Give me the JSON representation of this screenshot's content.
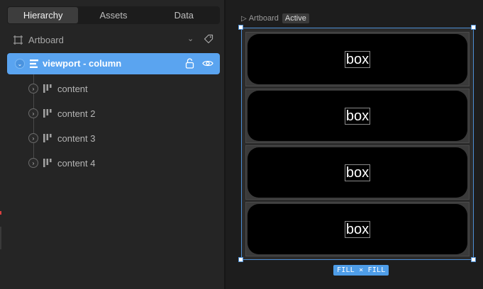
{
  "tabs": [
    {
      "label": "Hierarchy",
      "active": true
    },
    {
      "label": "Assets",
      "active": false
    },
    {
      "label": "Data",
      "active": false
    }
  ],
  "artboard_selector": {
    "label": "Artboard"
  },
  "selected_node": {
    "label": "viewport - column"
  },
  "children": [
    {
      "label": "content"
    },
    {
      "label": "content 2"
    },
    {
      "label": "content 3"
    },
    {
      "label": "content 4"
    }
  ],
  "canvas": {
    "breadcrumb": "Artboard",
    "state_badge": "Active",
    "boxes": [
      "box",
      "box",
      "box",
      "box"
    ],
    "size_badge": "FILL × FILL"
  },
  "colors": {
    "accent": "#5aa4f0",
    "panel": "#252525",
    "canvas": "#1d1d1d",
    "box_fill": "#000000"
  },
  "icons": [
    "artboard-icon",
    "chevron-down-icon",
    "tag-icon",
    "expand-icon",
    "column-layout-icon",
    "lock-icon",
    "eye-icon",
    "row-layout-icon",
    "play-icon"
  ]
}
